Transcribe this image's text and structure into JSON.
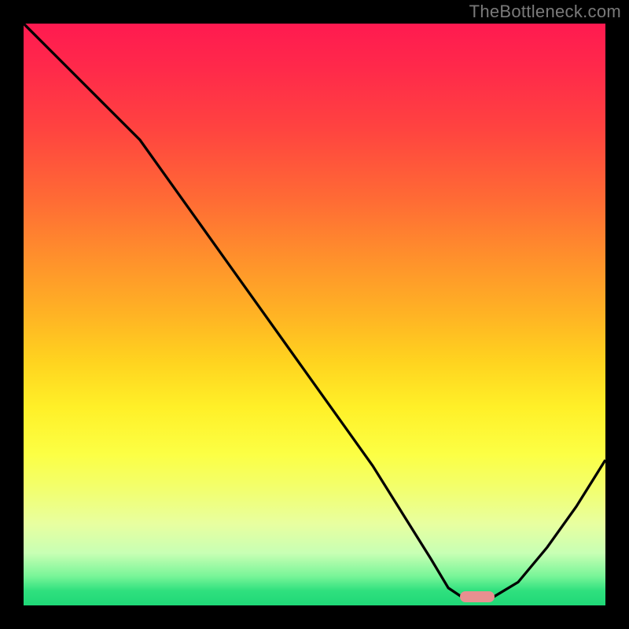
{
  "watermark": "TheBottleneck.com",
  "colors": {
    "frame_bg": "#000000",
    "marker": "#e89090",
    "curve": "#000000"
  },
  "chart_data": {
    "type": "line",
    "title": "",
    "xlabel": "",
    "ylabel": "",
    "xlim": [
      0,
      100
    ],
    "ylim": [
      0,
      100
    ],
    "x": [
      0,
      5,
      10,
      15,
      20,
      25,
      30,
      35,
      40,
      45,
      50,
      55,
      60,
      65,
      70,
      73,
      76,
      80,
      85,
      90,
      95,
      100
    ],
    "values": [
      100,
      95,
      90,
      85,
      80,
      73,
      66,
      59,
      52,
      45,
      38,
      31,
      24,
      16,
      8,
      3,
      1,
      1,
      4,
      10,
      17,
      25
    ],
    "marker_x_range": [
      75,
      81
    ],
    "marker_y": 1.5
  }
}
